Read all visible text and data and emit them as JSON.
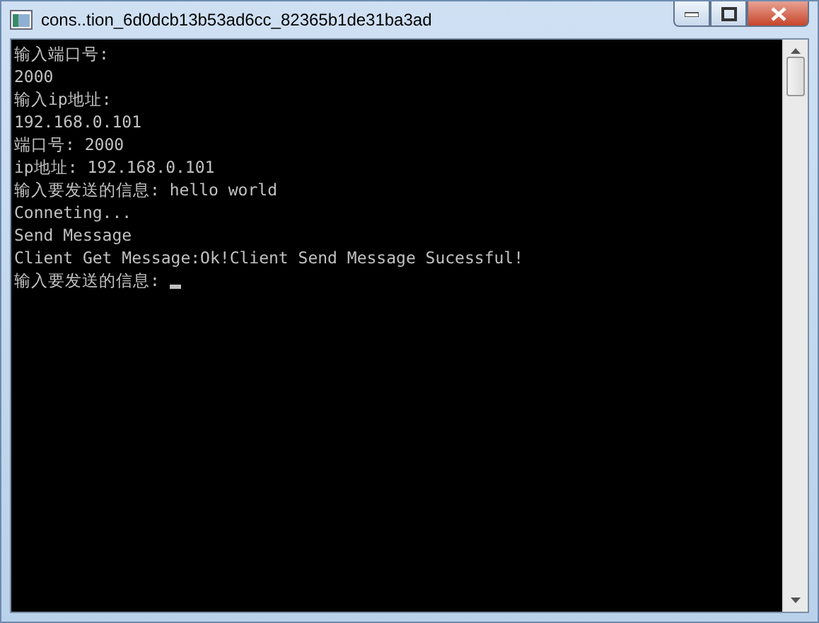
{
  "window": {
    "title": "cons..tion_6d0dcb13b53ad6cc_82365b1de31ba3ad"
  },
  "console": {
    "lines": [
      "输入端口号:",
      "2000",
      "输入ip地址:",
      "192.168.0.101",
      "端口号: 2000",
      "ip地址: 192.168.0.101",
      "输入要发送的信息: hello world",
      "Conneting...",
      "Send Message",
      "Client Get Message:Ok!Client Send Message Sucessful!",
      "输入要发送的信息: "
    ],
    "cursor_visible": true
  }
}
